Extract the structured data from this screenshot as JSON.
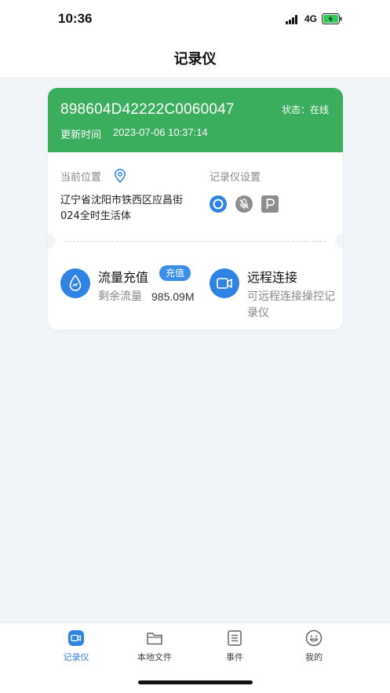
{
  "status_bar": {
    "time": "10:36",
    "network": "4G"
  },
  "header": {
    "title": "记录仪"
  },
  "device": {
    "id": "898604D42222C0060047",
    "status": "状态：在线",
    "update_label": "更新时间",
    "update_time": "2023-07-06 10:37:14"
  },
  "location": {
    "label": "当前位置",
    "address": "辽宁省沈阳市铁西区应昌街024全时生活体"
  },
  "settings": {
    "label": "记录仪设置",
    "icons": [
      "record-icon",
      "mic-mute-icon",
      "parking-icon"
    ]
  },
  "services": {
    "recharge": {
      "title": "流量充值",
      "badge": "充值",
      "remaining_label": "剩余流量",
      "remaining_value": "985.09M"
    },
    "remote": {
      "title": "远程连接",
      "desc": "可远程连接操控记录仪"
    }
  },
  "tabs": [
    {
      "label": "记录仪",
      "icon": "camera-tab-icon",
      "active": true
    },
    {
      "label": "本地文件",
      "icon": "folder-icon",
      "active": false
    },
    {
      "label": "事件",
      "icon": "list-icon",
      "active": false
    },
    {
      "label": "我的",
      "icon": "smile-icon",
      "active": false
    }
  ],
  "colors": {
    "accent": "#2f83e3",
    "header_green": "#3aae5c",
    "background": "#f2f5f8"
  }
}
